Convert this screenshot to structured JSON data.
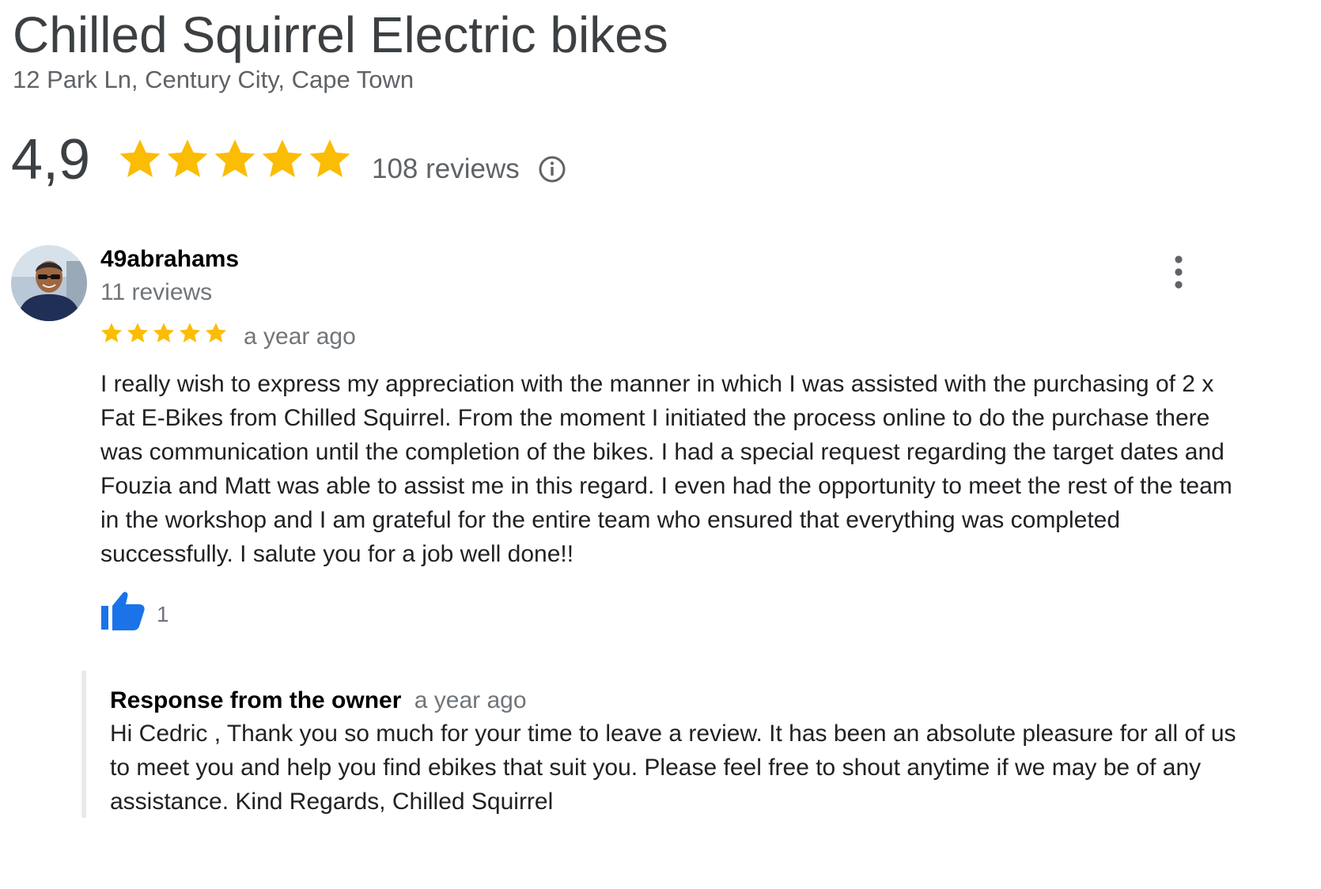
{
  "business": {
    "name": "Chilled Squirrel Electric bikes",
    "address": "12 Park Ln, Century City, Cape Town",
    "rating": "4,9",
    "rating_stars": 5,
    "review_count": "108 reviews",
    "star_color": "#fbbc04"
  },
  "review": {
    "reviewer_name": "49abrahams",
    "reviewer_reviews": "11 reviews",
    "stars": 5,
    "time": "a year ago",
    "text": "I really wish to express my appreciation with the manner in which I was assisted with the purchasing of 2 x Fat E-Bikes from Chilled Squirrel. From the moment I initiated the process online to do the purchase there was communication until the completion of the bikes. I had a special request regarding the target dates and Fouzia and Matt was able to assist me in this regard. I even had the opportunity to meet the rest of the team in the workshop and I am grateful for the entire team who ensured that everything was completed successfully. I salute you for a job well done!!",
    "like_count": "1",
    "like_color": "#1a73e8"
  },
  "owner_response": {
    "label": "Response from the owner",
    "time": "a year ago",
    "text": "Hi Cedric , Thank you so much for your time to leave a review. It has been an absolute pleasure for all of us to meet you and help you find ebikes that suit you. Please feel free to shout anytime if we may be of any assistance. Kind Regards, Chilled Squirrel"
  },
  "icons": {
    "info": "info-icon",
    "more": "more-vert-icon",
    "like": "thumbs-up-icon",
    "star": "star-icon",
    "avatar": "avatar"
  }
}
